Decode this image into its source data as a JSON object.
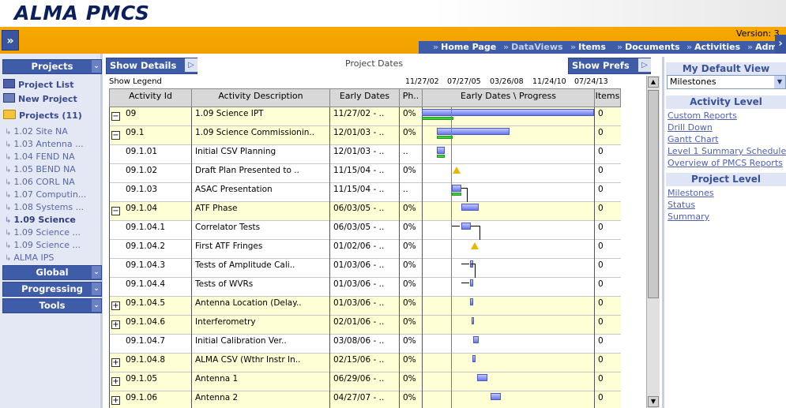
{
  "app": {
    "title": "ALMA PMCS",
    "version": "Version: 3"
  },
  "nav": {
    "items": [
      {
        "label": "Home Page",
        "dim": false
      },
      {
        "label": "DataViews",
        "dim": true
      },
      {
        "label": "Items",
        "dim": false
      },
      {
        "label": "Documents",
        "dim": false
      },
      {
        "label": "Activities",
        "dim": false
      },
      {
        "label": "Adm",
        "dim": false
      }
    ]
  },
  "sidebar": {
    "projects_header": "Projects",
    "project_list": "Project List",
    "new_project": "New Project",
    "projects_count": "Projects (11)",
    "tree": [
      "1.02 Site NA",
      "1.03 Antenna ...",
      "1.04 FEND NA",
      "1.05 BEND NA",
      "1.06 CORL NA",
      "1.07 Computin...",
      "1.08 Systems ...",
      "1.09 Science",
      "1.09 Science ...",
      "1.09 Science ...",
      "ALMA IPS"
    ],
    "current_index": 7,
    "global_header": "Global",
    "progressing_header": "Progressing",
    "tools_header": "Tools"
  },
  "main": {
    "show_details": "Show Details",
    "project_dates": "Project Dates",
    "show_prefs": "Show Prefs",
    "show_legend": "Show Legend",
    "scale_dates": [
      "11/27/02",
      "07/27/05",
      "03/26/08",
      "11/24/10",
      "07/24/13"
    ],
    "columns": {
      "activity_id": "Activity Id",
      "description": "Activity Description",
      "early_dates": "Early Dates",
      "phase": "Ph..",
      "gantt": "Early Dates \\ Progress",
      "items": "Items"
    },
    "rows": [
      {
        "id": "09",
        "desc": "1.09 Science IPT",
        "date": "11/27/02 - ..",
        "ph": "0%",
        "items": "0",
        "exp": "−",
        "hl": true
      },
      {
        "id": "09.1",
        "desc": "1.09 Science Commissionin..",
        "date": "12/01/03 - ..",
        "ph": "0%",
        "items": "0",
        "exp": "−",
        "hl": true
      },
      {
        "id": "09.1.01",
        "desc": "Initial CSV Planning",
        "date": "12/01/03 - ..",
        "ph": "..",
        "items": "0",
        "exp": "",
        "hl": false
      },
      {
        "id": "09.1.02",
        "desc": "Draft Plan Presented to ..",
        "date": "11/15/04 - ..",
        "ph": "0%",
        "items": "0",
        "exp": "",
        "hl": false
      },
      {
        "id": "09.1.03",
        "desc": "ASAC Presentation",
        "date": "11/15/04 - ..",
        "ph": "..",
        "items": "0",
        "exp": "",
        "hl": false
      },
      {
        "id": "09.1.04",
        "desc": "ATF Phase",
        "date": "06/03/05 - ..",
        "ph": "0%",
        "items": "0",
        "exp": "−",
        "hl": true
      },
      {
        "id": "09.1.04.1",
        "desc": "Correlator Tests",
        "date": "06/03/05 - ..",
        "ph": "0%",
        "items": "0",
        "exp": "",
        "hl": false
      },
      {
        "id": "09.1.04.2",
        "desc": "First ATF Fringes",
        "date": "01/02/06 - ..",
        "ph": "0%",
        "items": "0",
        "exp": "",
        "hl": false
      },
      {
        "id": "09.1.04.3",
        "desc": "Tests of Amplitude Cali..",
        "date": "01/03/06 - ..",
        "ph": "0%",
        "items": "0",
        "exp": "",
        "hl": false
      },
      {
        "id": "09.1.04.4",
        "desc": "Tests of WVRs",
        "date": "01/03/06 - ..",
        "ph": "0%",
        "items": "0",
        "exp": "",
        "hl": false
      },
      {
        "id": "09.1.04.5",
        "desc": "Antenna Location (Delay..",
        "date": "01/03/06 - ..",
        "ph": "0%",
        "items": "0",
        "exp": "+",
        "hl": true
      },
      {
        "id": "09.1.04.6",
        "desc": "Interferometry",
        "date": "02/01/06 - ..",
        "ph": "0%",
        "items": "0",
        "exp": "+",
        "hl": true
      },
      {
        "id": "09.1.04.7",
        "desc": "Initial Calibration Ver..",
        "date": "03/08/06 - ..",
        "ph": "0%",
        "items": "0",
        "exp": "",
        "hl": false
      },
      {
        "id": "09.1.04.8",
        "desc": "ALMA CSV (Wthr Instr In..",
        "date": "02/15/06 - ..",
        "ph": "0%",
        "items": "0",
        "exp": "+",
        "hl": true
      },
      {
        "id": "09.1.05",
        "desc": "Antenna 1",
        "date": "06/29/06 - ..",
        "ph": "0%",
        "items": "0",
        "exp": "+",
        "hl": true
      },
      {
        "id": "09.1.06",
        "desc": "Antenna 2",
        "date": "04/27/07 - ..",
        "ph": "0%",
        "items": "0",
        "exp": "+",
        "hl": true
      }
    ]
  },
  "right": {
    "default_view_header": "My Default View",
    "view_selected": "Milestones",
    "activity_level_header": "Activity Level",
    "activity_links": [
      "Custom Reports",
      "Drill Down",
      "Gantt Chart",
      "Level 1 Summary Schedule",
      "Overview of PMCS Reports"
    ],
    "project_level_header": "Project Level",
    "project_links": [
      "Milestones",
      "Status",
      "Summary"
    ]
  }
}
